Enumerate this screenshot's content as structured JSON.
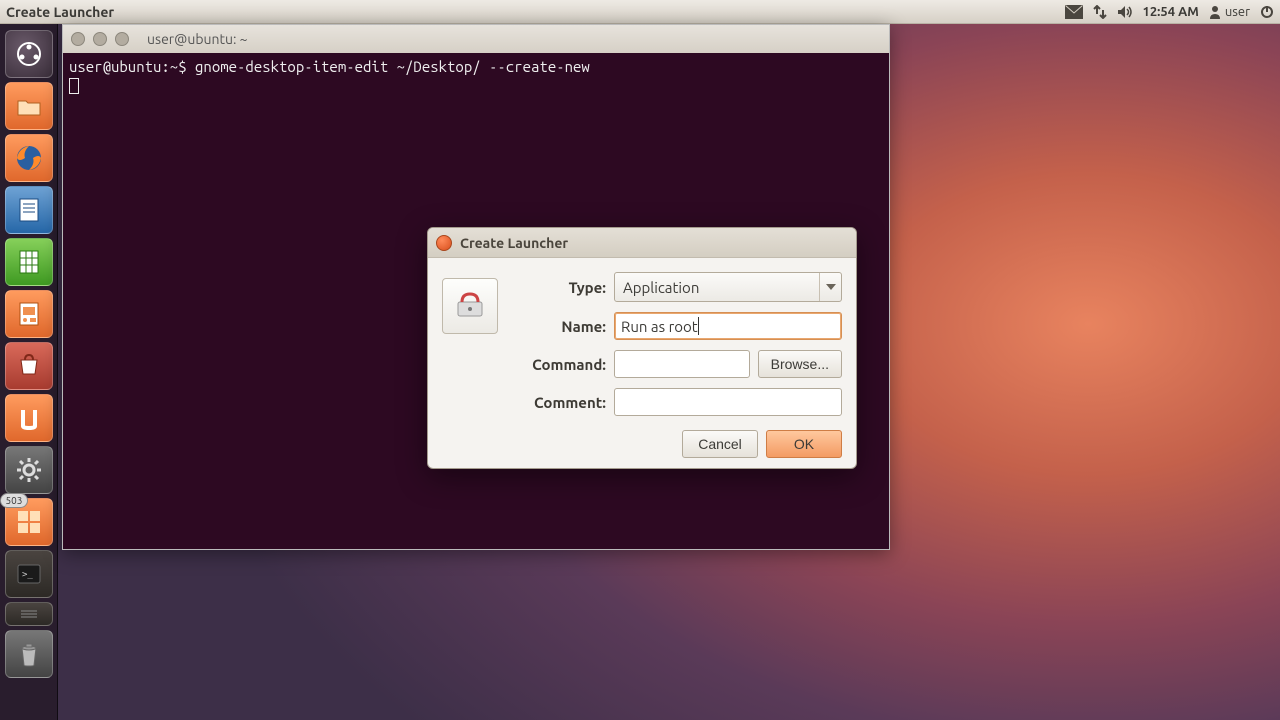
{
  "top_panel": {
    "app_title": "Create Launcher",
    "time": "12:54 AM",
    "user": "user"
  },
  "launcher": {
    "badge": "503"
  },
  "terminal": {
    "title": "user@ubuntu: ~",
    "prompt": "user@ubuntu:~$ ",
    "command": "gnome-desktop-item-edit ~/Desktop/ --create-new"
  },
  "dialog": {
    "title": "Create Launcher",
    "labels": {
      "type": "Type:",
      "name": "Name:",
      "command": "Command:",
      "comment": "Comment:"
    },
    "type_value": "Application",
    "name_value": "Run as root",
    "command_value": "",
    "comment_value": "",
    "browse": "Browse...",
    "cancel": "Cancel",
    "ok": "OK"
  }
}
